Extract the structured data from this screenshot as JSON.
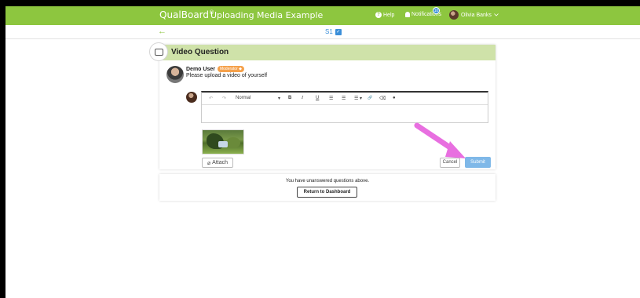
{
  "header": {
    "brand": "QualBoard",
    "brand_mark": "®",
    "page_title": "Uploading Media Example",
    "help_label": "Help",
    "notifications_label": "Notifications",
    "notifications_count": "10",
    "user_name": "Olivia Banks"
  },
  "subnav": {
    "section": "S1"
  },
  "question": {
    "title": "Video Question",
    "poster_name": "Demo User",
    "poster_role": "Moderator",
    "text": "Please upload a video of yourself"
  },
  "editor": {
    "undo": "↶",
    "redo": "↷",
    "style": "Normal",
    "bold": "B",
    "italic": "I",
    "underline": "U",
    "ordered_list": "☰",
    "bullet_list": "☰",
    "align": "☰",
    "link": "🔗",
    "clean": "⌫",
    "emoji": "●"
  },
  "actions": {
    "attach": "Attach",
    "cancel": "Cancel",
    "submit": "Submit"
  },
  "notice": {
    "text": "You have unanswered questions above.",
    "return_button": "Return to Dashboard"
  },
  "colors": {
    "topbar": "#8dc63f",
    "question_header": "#cfe2a9",
    "moderator_badge": "#f5a14b",
    "submit": "#7fb8e8",
    "arrow": "#e86fe0"
  }
}
